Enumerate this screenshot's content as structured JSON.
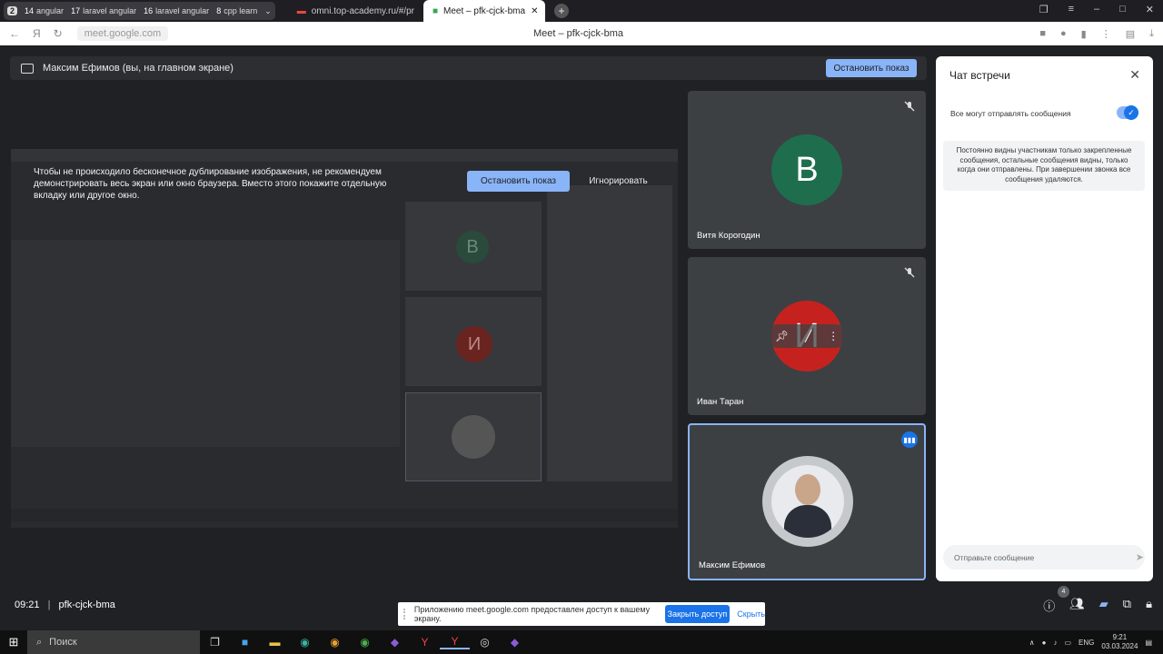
{
  "browser": {
    "workspace_number": "2",
    "tab_groups": [
      {
        "count": "14",
        "name": "angular"
      },
      {
        "count": "17",
        "name": "laravel angular"
      },
      {
        "count": "16",
        "name": "laravel angular"
      },
      {
        "count": "8",
        "name": "cpp learn"
      }
    ],
    "tabs": [
      {
        "label": "omni.top-academy.ru/#/pr"
      },
      {
        "label": "Meet – pfk-cjck-bma",
        "active": true
      }
    ],
    "url": "meet.google.com",
    "page_title": "Meet – pfk-cjck-bma"
  },
  "presentation": {
    "banner": "Максим Ефимов (вы, на главном экране)",
    "stop_label": "Остановить показ",
    "warning": "Чтобы не происходило бесконечное дублирование изображения, не рекомендуем демонстрировать весь экран или окно браузера. Вместо этого покажите отдельную вкладку или другое окно.",
    "stop_label_2": "Остановить показ",
    "ignore_label": "Игнорировать"
  },
  "participants": [
    {
      "name": "Витя Корогодин",
      "initial": "В",
      "color": "#1e6e4e"
    },
    {
      "name": "Иван Таран",
      "initial": "И",
      "color": "#c5221f"
    },
    {
      "name": "Максим Ефимов",
      "initial": "",
      "color": "#e8eaed"
    }
  ],
  "chat": {
    "title": "Чат встречи",
    "permission": "Все могут отправлять сообщения",
    "note": "Постоянно видны участникам только закрепленные сообщения, остальные сообщения видны, только когда они отправлены. При завершении звонка все сообщения удаляются.",
    "placeholder": "Отправьте сообщение"
  },
  "meeting": {
    "time": "09:21",
    "code": "pfk-cjck-bma",
    "people_count": "4"
  },
  "share_notice": {
    "message": "Приложению meet.google.com предоставлен доступ к вашему экрану.",
    "stop_label": "Закрыть доступ",
    "hide_label": "Скрыть"
  },
  "taskbar": {
    "search": "Поиск",
    "lang": "ENG",
    "time": "9:21",
    "date": "03.03.2024"
  },
  "colors": {
    "accent": "#8ab4f8",
    "meet_blue": "#1a73e8"
  }
}
